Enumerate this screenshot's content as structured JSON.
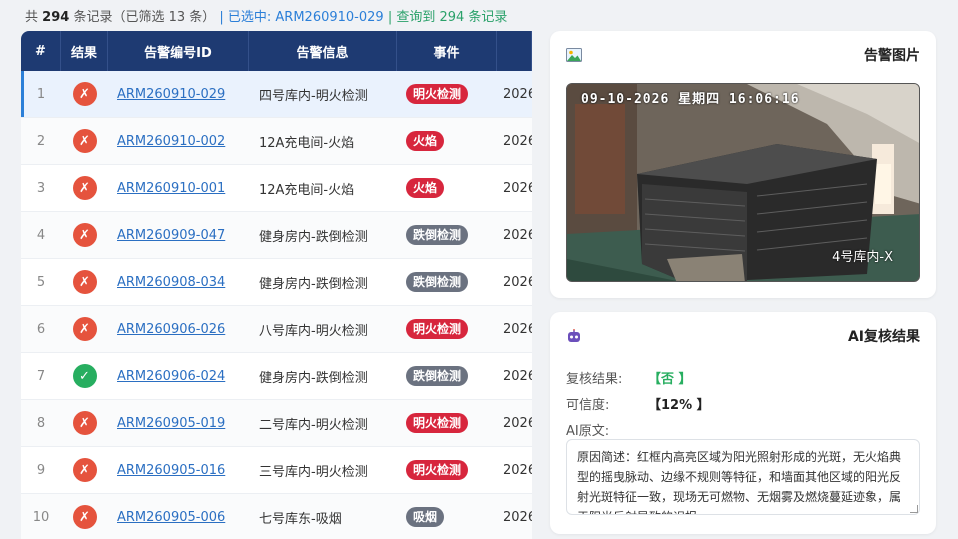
{
  "summary": {
    "prefix": "共",
    "total": "294",
    "records_filtered": "条记录（已筛选 13 条）",
    "selected": "| 已选中: ARM260910-029",
    "queried": "| 查询到 294 条记录"
  },
  "table": {
    "headers": [
      "#",
      "结果",
      "告警编号ID",
      "告警信息",
      "事件",
      ""
    ],
    "rows": [
      {
        "idx": "1",
        "result": "fail",
        "id": "ARM260910-029",
        "info": "四号库内-明火检测",
        "event": "明火检测",
        "event_color": "red",
        "time": "2026"
      },
      {
        "idx": "2",
        "result": "fail",
        "id": "ARM260910-002",
        "info": "12A充电间-火焰",
        "event": "火焰",
        "event_color": "red",
        "time": "2026"
      },
      {
        "idx": "3",
        "result": "fail",
        "id": "ARM260910-001",
        "info": "12A充电间-火焰",
        "event": "火焰",
        "event_color": "red",
        "time": "2026"
      },
      {
        "idx": "4",
        "result": "fail",
        "id": "ARM260909-047",
        "info": "健身房内-跌倒检测",
        "event": "跌倒检测",
        "event_color": "gray",
        "time": "2026"
      },
      {
        "idx": "5",
        "result": "fail",
        "id": "ARM260908-034",
        "info": "健身房内-跌倒检测",
        "event": "跌倒检测",
        "event_color": "gray",
        "time": "2026"
      },
      {
        "idx": "6",
        "result": "fail",
        "id": "ARM260906-026",
        "info": "八号库内-明火检测",
        "event": "明火检测",
        "event_color": "red",
        "time": "2026"
      },
      {
        "idx": "7",
        "result": "pass",
        "id": "ARM260906-024",
        "info": "健身房内-跌倒检测",
        "event": "跌倒检测",
        "event_color": "gray",
        "time": "2026"
      },
      {
        "idx": "8",
        "result": "fail",
        "id": "ARM260905-019",
        "info": "二号库内-明火检测",
        "event": "明火检测",
        "event_color": "red",
        "time": "2026"
      },
      {
        "idx": "9",
        "result": "fail",
        "id": "ARM260905-016",
        "info": "三号库内-明火检测",
        "event": "明火检测",
        "event_color": "red",
        "time": "2026"
      },
      {
        "idx": "10",
        "result": "fail",
        "id": "ARM260905-006",
        "info": "七号库东-吸烟",
        "event": "吸烟",
        "event_color": "gray",
        "time": "2026"
      }
    ]
  },
  "alarm_image": {
    "title": "告警图片",
    "osd_datetime": "09-10-2026 星期四 16:06:16",
    "osd_camera": "4号库内-X"
  },
  "ai_review": {
    "title": "AI复核结果",
    "result_label": "复核结果:",
    "result_value": "【否 】",
    "confidence_label": "可信度:",
    "confidence_value": "【12% 】",
    "raw_label": "AI原文:",
    "raw_text": "原因简述：红框内高亮区域为阳光照射形成的光斑，无火焰典型的摇曳脉动、边缘不规则等特征，和墙面其他区域的阳光反射光斑特征一致，现场无可燃物、无烟雾及燃烧蔓延迹象，属于阳光反射导致的误报"
  },
  "colors": {
    "header_bg": "#1e3a72",
    "tag_red": "#d7263d",
    "tag_gray": "#6b7280",
    "fail": "#e5533d",
    "pass": "#27ae60",
    "link": "#2b6fc2"
  }
}
